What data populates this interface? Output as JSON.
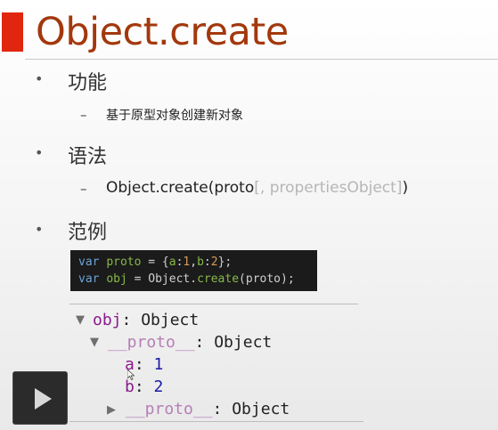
{
  "slide": {
    "title": "Object.create",
    "sections": [
      {
        "heading": "功能",
        "sub": "基于原型对象创建新对象"
      },
      {
        "heading": "语法",
        "syntax_main": "Object.create(proto",
        "syntax_optional": "[, propertiesObject]",
        "syntax_close": ")"
      },
      {
        "heading": "范例"
      }
    ],
    "bullet_char": "•",
    "dash_char": "–"
  },
  "code": {
    "line1": {
      "kw": "var",
      "name": "proto",
      "rest_a": " = {",
      "a_key": "a",
      "a_sep": ":",
      "a_val": "1",
      "comma": ",",
      "b_key": "b",
      "b_sep": ":",
      "b_val": "2",
      "end": "};"
    },
    "line2": {
      "kw": "var",
      "name": "obj",
      "rest_a": " = ",
      "obj": "Object",
      "dot": ".",
      "fn": "create",
      "args": "(proto);"
    }
  },
  "console": {
    "obj_label": "obj",
    "obj_type": ": Object",
    "proto_label": "__proto__",
    "proto_type": ": Object",
    "prop_a_key": "a",
    "prop_a_val": "1",
    "prop_b_key": "b",
    "prop_b_val": "2",
    "proto2_label": "__proto__",
    "proto2_type": ": Object"
  },
  "player": {
    "play_icon": "play-icon"
  }
}
